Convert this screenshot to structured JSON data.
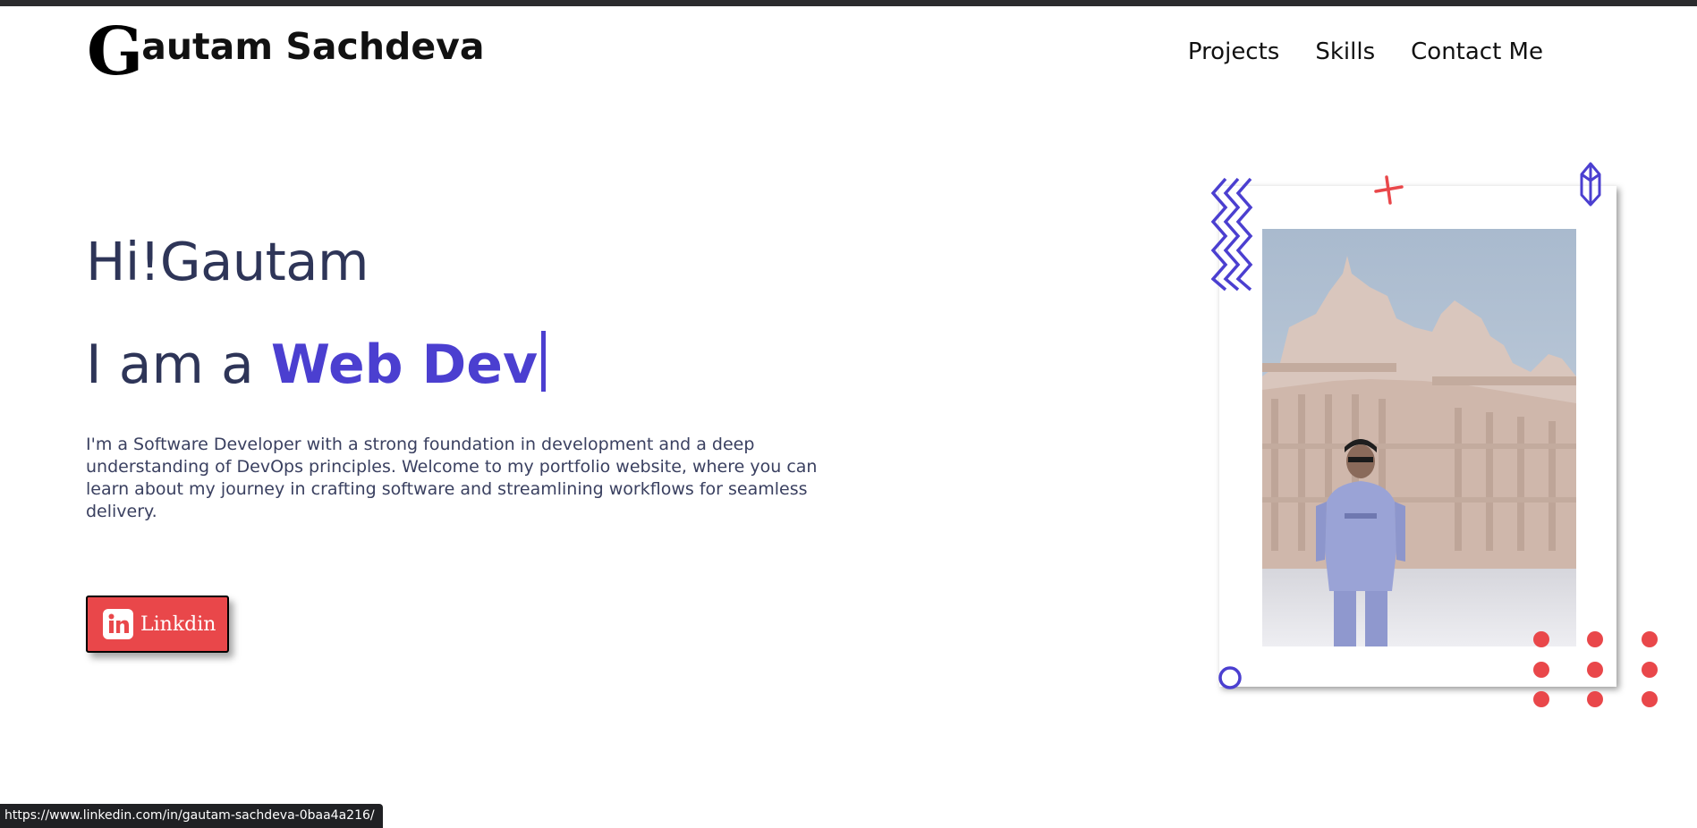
{
  "header": {
    "logo_initial": "G",
    "logo_rest": "autam Sachdeva",
    "nav": [
      {
        "label": "Projects"
      },
      {
        "label": "Skills"
      },
      {
        "label": "Contact Me"
      }
    ]
  },
  "hero": {
    "greeting": "Hi!Gautam",
    "role_prefix": "I am a ",
    "role_typed": "Web Dev",
    "bio": "I'm a Software Developer with a strong foundation in development and a deep understanding of DevOps principles. Welcome to my portfolio website, where you can learn about my journey in crafting software and streamlining workflows for seamless delivery.",
    "linkedin_label": "Linkdin"
  },
  "status_bar": {
    "url": "https://www.linkedin.com/in/gautam-sachdeva-0baa4a216/"
  },
  "colors": {
    "accent_purple": "#4b3fd0",
    "accent_red": "#e9474a",
    "heading_navy": "#2e3558",
    "text": "#111111"
  },
  "icons": {
    "linkedin": "linkedin-icon",
    "zigzag": "zigzag-decoration",
    "cross": "cross-decoration",
    "gem": "gem-decoration",
    "ring": "ring-decoration",
    "dots": "dot-grid-decoration"
  }
}
